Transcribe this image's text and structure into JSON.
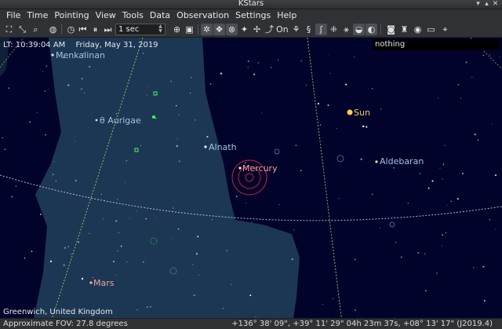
{
  "window": {
    "title": "KStars"
  },
  "menu": [
    "File",
    "Time",
    "Pointing",
    "View",
    "Tools",
    "Data",
    "Observation",
    "Settings",
    "Help"
  ],
  "toolbar": {
    "time_step": "1 sec",
    "icons": [
      "fullscreen-icon",
      "zoom-fit-icon",
      "search-icon",
      "globe-icon",
      "clock-icon",
      "step-back-icon",
      "pause-icon",
      "step-forward-icon"
    ],
    "toggles": [
      "stars-icon",
      "deep-sky-icon",
      "solar-system-icon",
      "supernovae-icon",
      "comets-icon",
      "constellation-lines-icon",
      "constellation-names-icon",
      "satellites-icon",
      "milky-way-icon",
      "equatorial-grid-icon",
      "horizontal-grid-icon",
      "ground-icon",
      "horizon-icon",
      "flags-icon",
      "hips-icon",
      "sensor-fov-icon",
      "mosaic-icon",
      "target-icon"
    ]
  },
  "skymap": {
    "local_time": "LT: 10:39:04 AM",
    "date": "Friday, May 31, 2019",
    "focus_object": "nothing",
    "labels": {
      "menkalinan": "Menkalinan",
      "theta_aurigae": "θ Aurigae",
      "alnath": "Alnath",
      "mercury": "Mercury",
      "sun": "Sun",
      "aldebaran": "Aldebaran",
      "mars": "Mars"
    },
    "location": "Greenwich, United Kingdom"
  },
  "status": {
    "fov": "Approximate FOV: 27.8 degrees",
    "coordinates": "+136° 38' 09\", +39° 11' 29\" 04h 23m 37s, +08° 13' 17\" (J2019.4)"
  },
  "colors": {
    "sky": "#02032a",
    "milky_way": "#1d3a55",
    "grid": "#b8d870",
    "star_label": "#9ec4e6",
    "planet_label": "#f0a0a0",
    "sun": "#ffcc55"
  }
}
